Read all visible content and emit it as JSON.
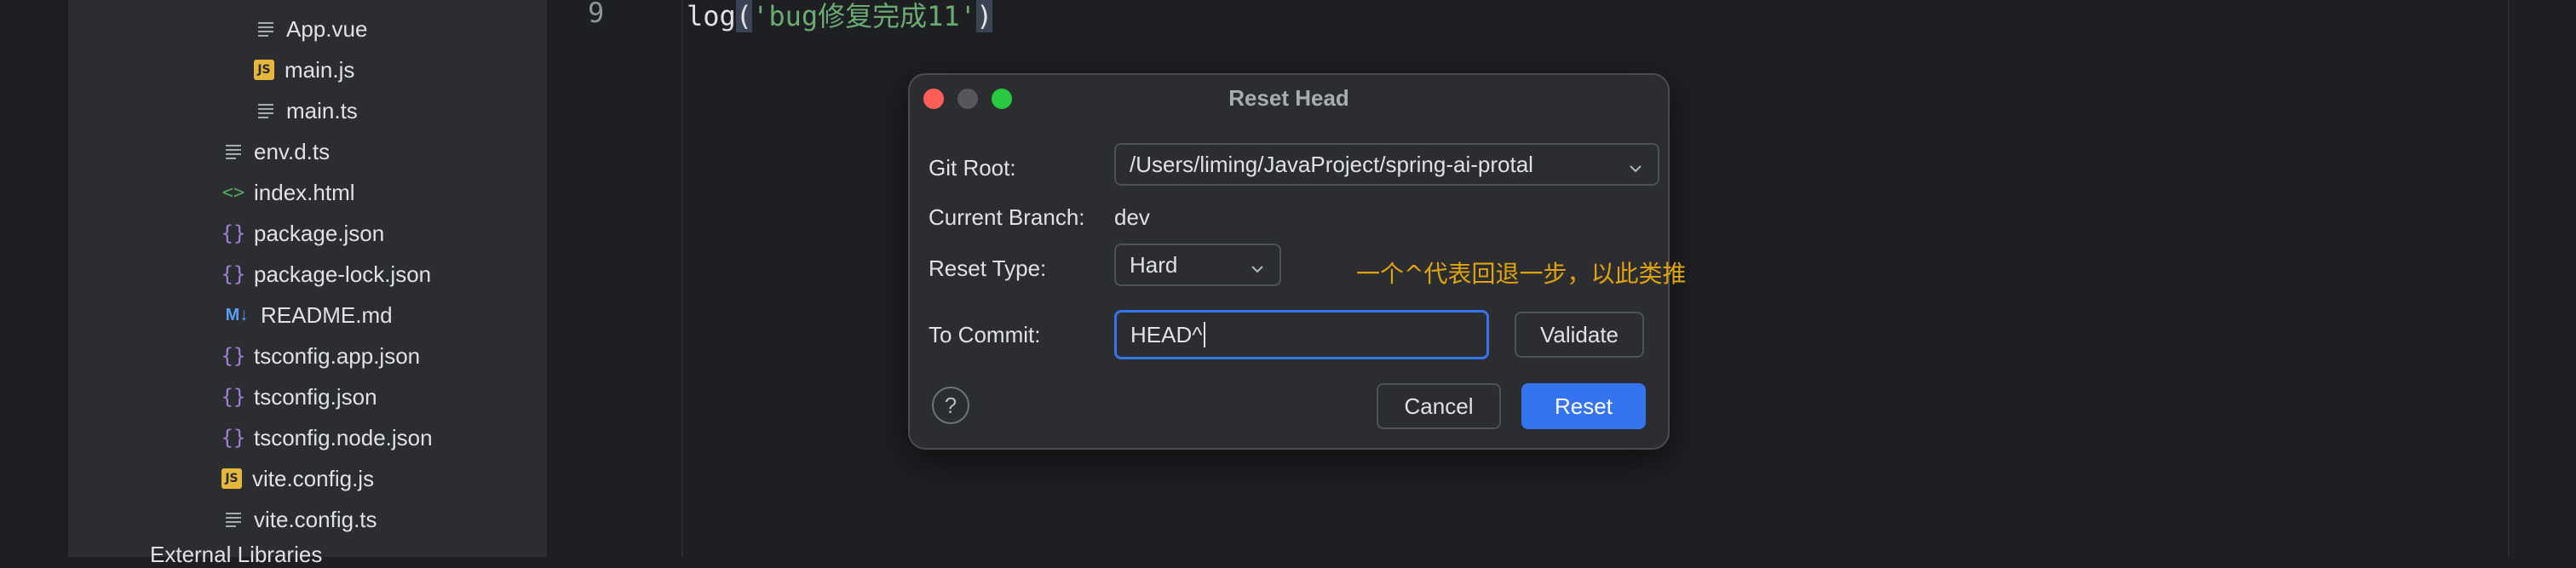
{
  "project_tree": {
    "items": [
      {
        "name": "App.vue",
        "icon": "text-file-icon"
      },
      {
        "name": "main.js",
        "icon": "js-file-icon"
      },
      {
        "name": "main.ts",
        "icon": "text-file-icon"
      },
      {
        "name": "env.d.ts",
        "icon": "text-file-icon"
      },
      {
        "name": "index.html",
        "icon": "html-file-icon"
      },
      {
        "name": "package.json",
        "icon": "json-file-icon"
      },
      {
        "name": "package-lock.json",
        "icon": "json-file-icon"
      },
      {
        "name": "README.md",
        "icon": "markdown-file-icon"
      },
      {
        "name": "tsconfig.app.json",
        "icon": "json-file-icon"
      },
      {
        "name": "tsconfig.json",
        "icon": "json-file-icon"
      },
      {
        "name": "tsconfig.node.json",
        "icon": "json-file-icon"
      },
      {
        "name": "vite.config.js",
        "icon": "js-file-icon"
      },
      {
        "name": "vite.config.ts",
        "icon": "text-file-icon"
      }
    ],
    "partial_label": "External Libraries"
  },
  "editor": {
    "line_number": "9",
    "code_fn": "log",
    "code_open": "(",
    "code_string": "'bug修复完成11'",
    "code_close": ")"
  },
  "dialog": {
    "title": "Reset Head",
    "git_root_label": "Git Root:",
    "git_root_value": "/Users/liming/JavaProject/spring-ai-protal",
    "current_branch_label": "Current Branch:",
    "current_branch_value": "dev",
    "reset_type_label": "Reset Type:",
    "reset_type_value": "Hard",
    "to_commit_label": "To Commit:",
    "to_commit_value": "HEAD^",
    "validate_label": "Validate",
    "cancel_label": "Cancel",
    "reset_label": "Reset",
    "help_label": "?"
  },
  "annotation": "一个^代表回退一步，以此类推",
  "colors": {
    "accent": "#3574f0",
    "annotation": "#e0a30e",
    "string": "#6aab73"
  }
}
